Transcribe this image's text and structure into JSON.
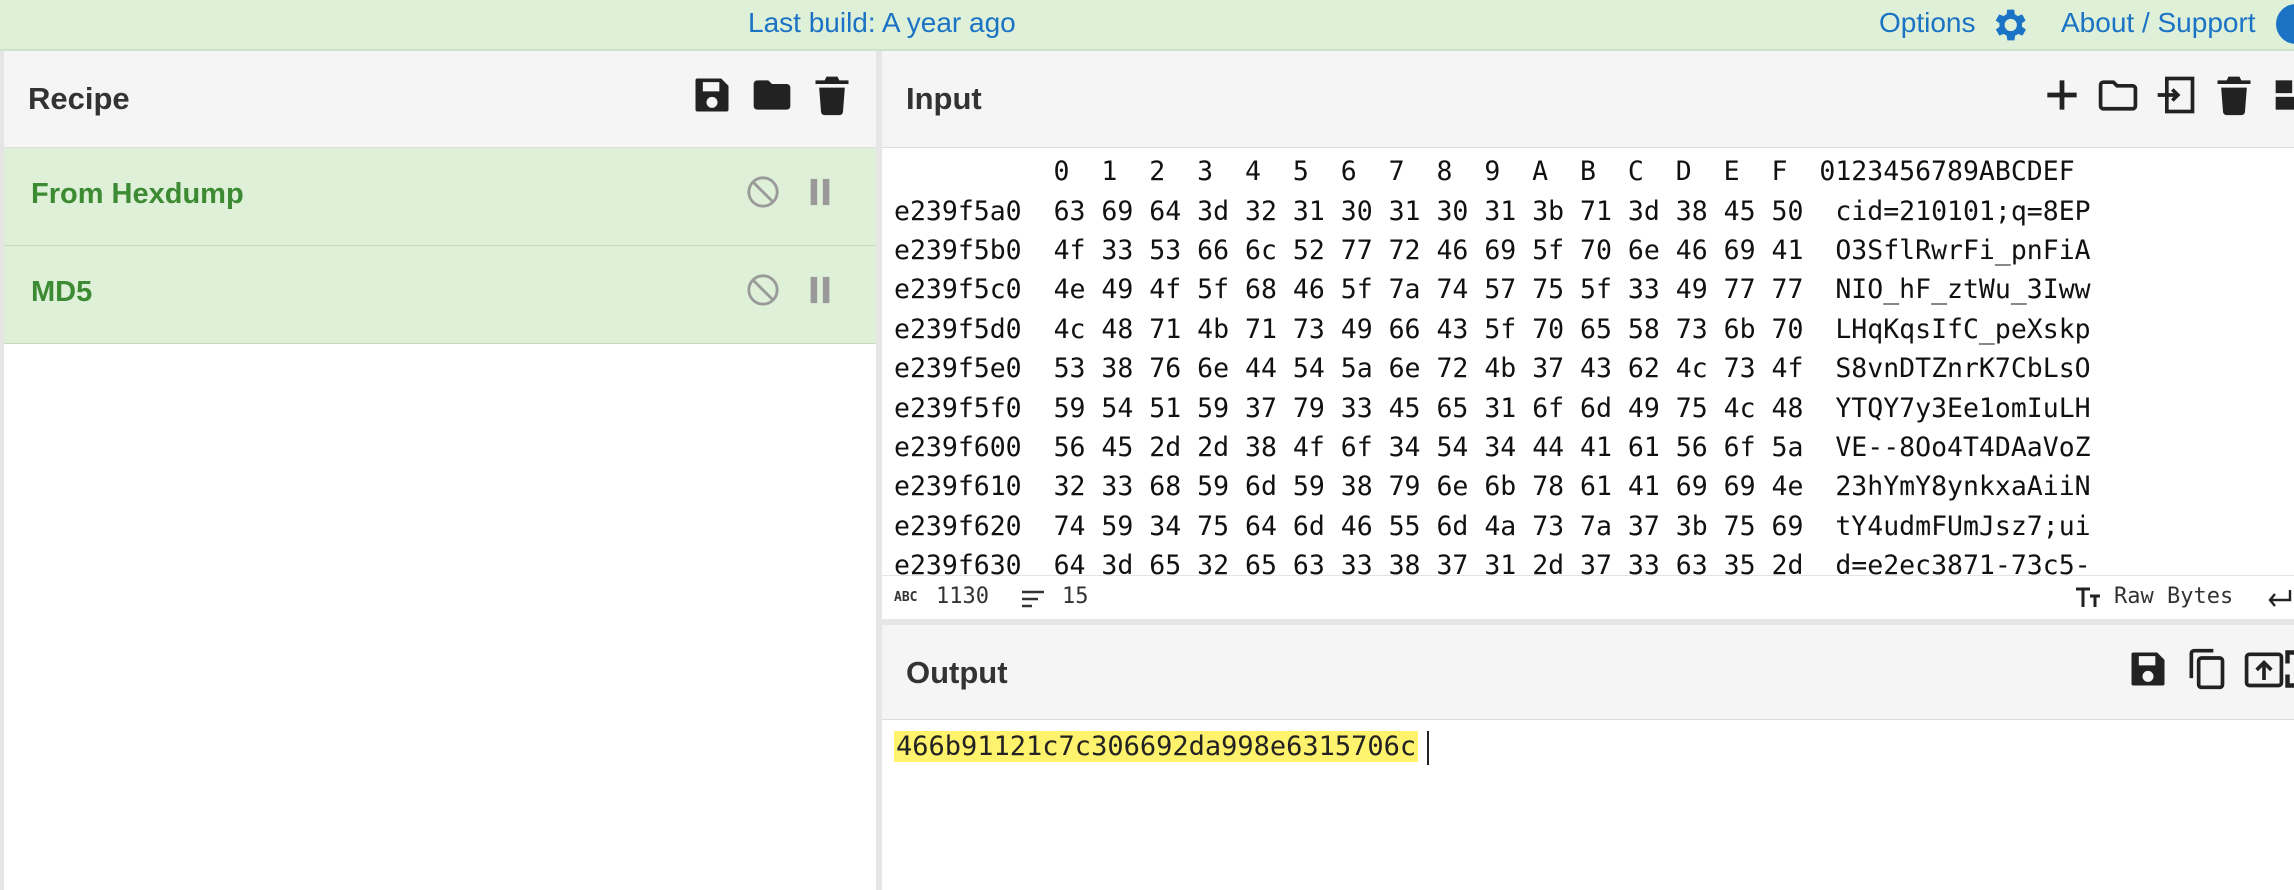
{
  "banner": {
    "last_build": "Last build: A year ago",
    "options_label": "Options",
    "about_label": "About / Support"
  },
  "recipe": {
    "title": "Recipe",
    "operations": [
      {
        "name": "From Hexdump"
      },
      {
        "name": "MD5"
      }
    ]
  },
  "input": {
    "title": "Input",
    "header_row": "0  1  2  3  4  5  6  7  8  9  A  B  C  D  E  F",
    "header_ascii": "0123456789ABCDEF",
    "rows": [
      {
        "offset": "e239f5a0",
        "hex": "63 69 64 3d 32 31 30 31 30 31 3b 71 3d 38 45 50",
        "ascii": "cid=210101;q=8EP"
      },
      {
        "offset": "e239f5b0",
        "hex": "4f 33 53 66 6c 52 77 72 46 69 5f 70 6e 46 69 41",
        "ascii": "O3SflRwrFi_pnFiA"
      },
      {
        "offset": "e239f5c0",
        "hex": "4e 49 4f 5f 68 46 5f 7a 74 57 75 5f 33 49 77 77",
        "ascii": "NIO_hF_ztWu_3Iww"
      },
      {
        "offset": "e239f5d0",
        "hex": "4c 48 71 4b 71 73 49 66 43 5f 70 65 58 73 6b 70",
        "ascii": "LHqKqsIfC_peXskp"
      },
      {
        "offset": "e239f5e0",
        "hex": "53 38 76 6e 44 54 5a 6e 72 4b 37 43 62 4c 73 4f",
        "ascii": "S8vnDTZnrK7CbLsO"
      },
      {
        "offset": "e239f5f0",
        "hex": "59 54 51 59 37 79 33 45 65 31 6f 6d 49 75 4c 48",
        "ascii": "YTQY7y3Ee1omIuLH"
      },
      {
        "offset": "e239f600",
        "hex": "56 45 2d 2d 38 4f 6f 34 54 34 44 41 61 56 6f 5a",
        "ascii": "VE--8Oo4T4DAaVoZ"
      },
      {
        "offset": "e239f610",
        "hex": "32 33 68 59 6d 59 38 79 6e 6b 78 61 41 69 69 4e",
        "ascii": "23hYmY8ynkxaAiiN"
      },
      {
        "offset": "e239f620",
        "hex": "74 59 34 75 64 6d 46 55 6d 4a 73 7a 37 3b 75 69",
        "ascii": "tY4udmFUmJsz7;ui"
      },
      {
        "offset": "e239f630",
        "hex": "64 3d 65 32 65 63 33 38 37 31 2d 37 33 63 35 2d",
        "ascii": "d=e2ec3871-73c5-"
      }
    ],
    "status": {
      "abc_label": "ABC",
      "char_count": "1130",
      "line_count": "15",
      "encoding_label": "Raw Bytes"
    }
  },
  "output": {
    "title": "Output",
    "value": "466b91121c7c306692da998e6315706c"
  },
  "colors": {
    "banner_bg": "#dff0d8",
    "link": "#1a73c4",
    "operation_bg": "#dff0d8",
    "operation_text": "#3c8b33",
    "highlight": "#fff36e"
  }
}
